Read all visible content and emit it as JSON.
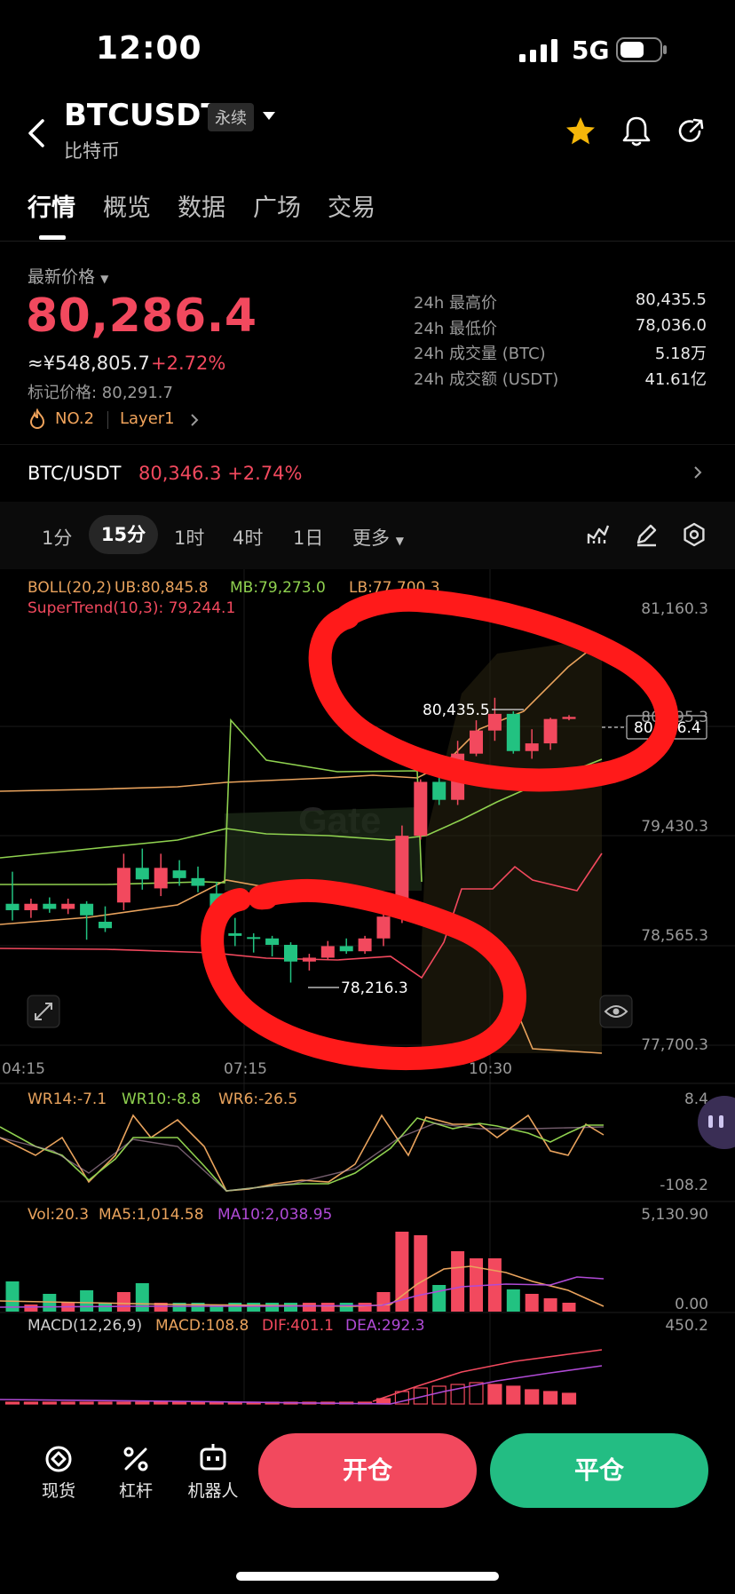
{
  "status": {
    "time": "12:00",
    "network": "5G"
  },
  "header": {
    "symbol": "BTCUSDT",
    "contract_type": "永续",
    "name_cn": "比特币"
  },
  "tabs": [
    "行情",
    "概览",
    "数据",
    "广场",
    "交易"
  ],
  "price": {
    "latest_label": "最新价格",
    "last": "80,286.4",
    "cny": "≈¥548,805.7",
    "change": "+2.72%",
    "mark_price": "标记价格: 80,291.7",
    "rank": "NO.2",
    "sector": "Layer1"
  },
  "stats": [
    {
      "label": "24h 最高价",
      "value": "80,435.5"
    },
    {
      "label": "24h 最低价",
      "value": "78,036.0"
    },
    {
      "label": "24h 成交量 (BTC)",
      "value": "5.18万"
    },
    {
      "label": "24h 成交额 (USDT)",
      "value": "41.61亿"
    }
  ],
  "spot": {
    "pair": "BTC/USDT",
    "price_change": "80,346.3 +2.74%"
  },
  "timeframes": [
    "1分",
    "15分",
    "1时",
    "4时",
    "1日",
    "更多"
  ],
  "timeframe_selected": "15分",
  "indicators": {
    "boll": "BOLL(20,2)",
    "boll_ub": "UB:80,845.8",
    "boll_mb": "MB:79,273.0",
    "boll_lb": "LB:77,700.3",
    "supertrend": "SuperTrend(10,3): 79,244.1",
    "wr14": "WR14:-7.1",
    "wr10": "WR10:-8.8",
    "wr6": "WR6:-26.5",
    "vol": "Vol:20.3",
    "ma5": "MA5:1,014.58",
    "ma10": "MA10:2,038.95",
    "macd": "MACD(12,26,9)",
    "macd_val": "MACD:108.8",
    "dif": "DIF:401.1",
    "dea": "DEA:292.3"
  },
  "axis": {
    "price_ticks": [
      "81,160.3",
      "80,295.3",
      "79,430.3",
      "78,565.3",
      "77,700.3"
    ],
    "time_ticks": [
      "04:15",
      "07:15",
      "10:30"
    ],
    "wr_ticks": [
      "8.4",
      "-108.2"
    ],
    "vol_ticks": [
      "5,130.90",
      "0.00"
    ],
    "macd_tick": "450.2",
    "high_marker": "80,435.5",
    "low_marker": "78,216.3",
    "current_marker": "80,286.4",
    "watermark": "Gate"
  },
  "chart_data": {
    "type": "candlestick",
    "interval": "15分",
    "ylim": [
      77700.3,
      81160.3
    ],
    "candles": [
      {
        "o": 78830,
        "h": 79080,
        "l": 78700,
        "c": 78780
      },
      {
        "o": 78780,
        "h": 78870,
        "l": 78720,
        "c": 78830
      },
      {
        "o": 78830,
        "h": 78880,
        "l": 78760,
        "c": 78790
      },
      {
        "o": 78790,
        "h": 78870,
        "l": 78750,
        "c": 78830
      },
      {
        "o": 78830,
        "h": 78850,
        "l": 78550,
        "c": 78740
      },
      {
        "o": 78690,
        "h": 78810,
        "l": 78610,
        "c": 78640
      },
      {
        "o": 78840,
        "h": 79220,
        "l": 78780,
        "c": 79110
      },
      {
        "o": 79110,
        "h": 79260,
        "l": 78940,
        "c": 79020
      },
      {
        "o": 78950,
        "h": 79220,
        "l": 78890,
        "c": 79110
      },
      {
        "o": 79090,
        "h": 79170,
        "l": 78970,
        "c": 79030
      },
      {
        "o": 79030,
        "h": 79120,
        "l": 78920,
        "c": 78970
      },
      {
        "o": 78910,
        "h": 79000,
        "l": 78470,
        "c": 78600
      },
      {
        "o": 78600,
        "h": 78720,
        "l": 78500,
        "c": 78580
      },
      {
        "o": 78570,
        "h": 78600,
        "l": 78450,
        "c": 78560
      },
      {
        "o": 78560,
        "h": 78580,
        "l": 78420,
        "c": 78510
      },
      {
        "o": 78510,
        "h": 78530,
        "l": 78216,
        "c": 78380
      },
      {
        "o": 78380,
        "h": 78440,
        "l": 78310,
        "c": 78410
      },
      {
        "o": 78410,
        "h": 78540,
        "l": 78390,
        "c": 78500
      },
      {
        "o": 78500,
        "h": 78560,
        "l": 78440,
        "c": 78460
      },
      {
        "o": 78460,
        "h": 78580,
        "l": 78440,
        "c": 78560
      },
      {
        "o": 78560,
        "h": 78780,
        "l": 78500,
        "c": 78730
      },
      {
        "o": 78730,
        "h": 79440,
        "l": 78680,
        "c": 79360
      },
      {
        "o": 79360,
        "h": 79800,
        "l": 79330,
        "c": 79780
      },
      {
        "o": 79780,
        "h": 79840,
        "l": 79600,
        "c": 79640
      },
      {
        "o": 79640,
        "h": 80100,
        "l": 79600,
        "c": 80000
      },
      {
        "o": 80000,
        "h": 80260,
        "l": 79980,
        "c": 80180
      },
      {
        "o": 80180,
        "h": 80435.5,
        "l": 80100,
        "c": 80310
      },
      {
        "o": 80310,
        "h": 80330,
        "l": 80000,
        "c": 80020
      },
      {
        "o": 80020,
        "h": 80190,
        "l": 79960,
        "c": 80080
      },
      {
        "o": 80080,
        "h": 80280,
        "l": 80030,
        "c": 80270
      },
      {
        "o": 80270,
        "h": 80300,
        "l": 80260,
        "c": 80286.4
      }
    ]
  },
  "bottom_nav": [
    "现货",
    "杠杆",
    "机器人"
  ],
  "actions": {
    "open": "开仓",
    "close": "平仓"
  },
  "colors": {
    "up": "#f2495e",
    "down": "#22c281",
    "open_btn": "#f2495e",
    "close_btn": "#23bd83"
  }
}
